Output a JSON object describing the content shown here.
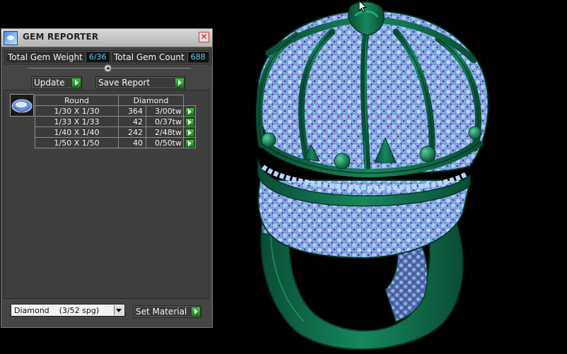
{
  "panel": {
    "title": "GEM REPORTER",
    "close_icon": "close-icon",
    "app_icon": "gem-reporter-icon"
  },
  "stats": {
    "total_weight_label": "Total Gem Weight",
    "total_weight_value": "6/36",
    "total_count_label": "Total Gem Count",
    "total_count_value": "688"
  },
  "actions": {
    "update_label": "Update",
    "save_report_label": "Save Report"
  },
  "gem_table": {
    "headers": [
      "Round",
      "Diamond"
    ],
    "rows": [
      {
        "size": "1/30 X 1/30",
        "count": "364",
        "weight": "3/00tw"
      },
      {
        "size": "1/33 X 1/33",
        "count": "42",
        "weight": "0/37tw"
      },
      {
        "size": "1/40 X 1/40",
        "count": "242",
        "weight": "2/48tw"
      },
      {
        "size": "1/50 X 1/50",
        "count": "40",
        "weight": "0/50tw"
      }
    ]
  },
  "material": {
    "selected": "Diamond    (3/52 spg)",
    "set_label": "Set Material"
  },
  "colors": {
    "metal": "#0f6b4a",
    "gem": "#9ec8f5",
    "bead": "#7a1fa8",
    "accent_value": "#5ad0f0",
    "go_green": "#2fa834"
  }
}
